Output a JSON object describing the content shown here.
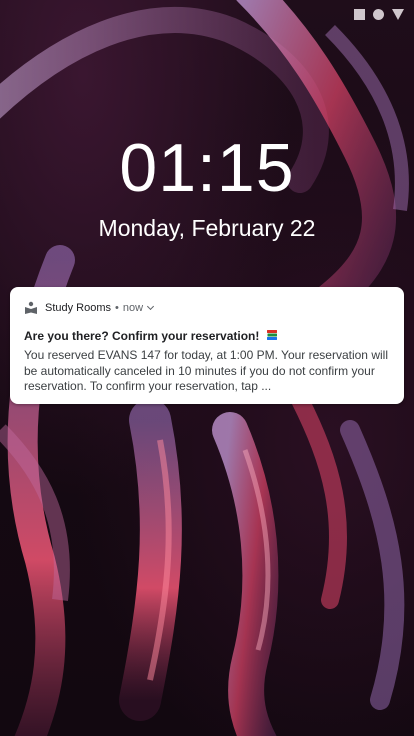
{
  "system": {
    "nav_icons": [
      "square-icon",
      "circle-icon",
      "triangle-icon"
    ]
  },
  "lockscreen": {
    "time": "01:15",
    "date": "Monday, February 22"
  },
  "notification": {
    "app_name": "Study Rooms",
    "separator": "•",
    "time": "now",
    "title": "Are you there? Confirm your reservation!",
    "title_emoji_icon": "books-icon",
    "body": "You reserved EVANS 147 for today, at 1:00 PM. Your reservation will be automatically canceled in 10 minutes if you do not confirm your reservation. To confirm your reservation, tap ...",
    "app_icon": "book-reader-icon"
  },
  "colors": {
    "wallpaper_dark": "#150912",
    "accent_pink": "#ff5a7a",
    "accent_violet": "#b48ac9",
    "card_bg": "#ffffff"
  }
}
